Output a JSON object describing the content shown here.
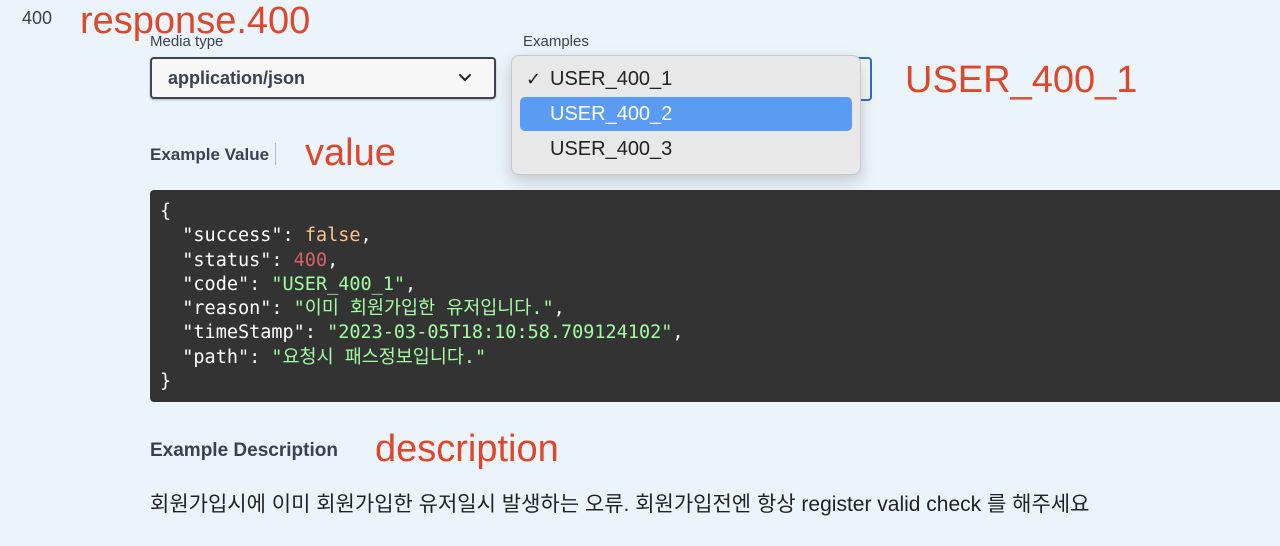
{
  "response": {
    "status_code": "400",
    "annotation": "response.400"
  },
  "media_type": {
    "label": "Media type",
    "value": "application/json"
  },
  "examples": {
    "label": "Examples",
    "options": [
      "USER_400_1",
      "USER_400_2",
      "USER_400_3"
    ],
    "checked": "USER_400_1",
    "highlighted": "USER_400_2",
    "annotation": "USER_400_1"
  },
  "example_value": {
    "tab_label": "Example Value",
    "annotation": "value",
    "code": {
      "success": "false",
      "status": "400",
      "code": "\"USER_400_1\"",
      "reason": "\"이미 회원가입한 유저입니다.\"",
      "timeStamp": "\"2023-03-05T18:10:58.709124102\"",
      "path": "\"요청시 패스정보입니다.\""
    }
  },
  "example_description": {
    "label": "Example Description",
    "annotation": "description",
    "text": "회원가입시에 이미 회원가입한 유저일시 발생하는 오류. 회원가입전엔 항상 register valid check 를 해주세요"
  },
  "colors": {
    "annotation": "#e0462a",
    "background": "#ebf3fb",
    "code_background": "#333333",
    "highlight": "#5a9cf3"
  }
}
